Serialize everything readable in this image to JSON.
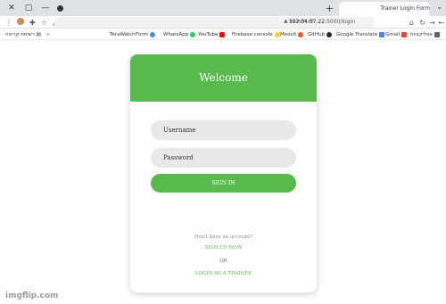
{
  "tab": {
    "title": "Trainer Login Form"
  },
  "toolbar": {
    "secure_label": "לא מאובטח",
    "url_host": "192.34.57.22",
    "url_path": ":5000/login"
  },
  "bookmarks": [
    {
      "label": "TeraWatch"
    },
    {
      "label": "Form"
    },
    {
      "label": "WhatsApp"
    },
    {
      "label": "YouTube"
    },
    {
      "label": "Firebase console"
    },
    {
      "label": "Moovit"
    },
    {
      "label": "GitHub"
    },
    {
      "label": "Google Translate"
    },
    {
      "label": "Gmail"
    },
    {
      "label": "אפליקציות"
    },
    {
      "label": "רשימת קריאה"
    }
  ],
  "card": {
    "title": "Welcome",
    "username_placeholder": "Username",
    "password_placeholder": "Password",
    "signin_label": "SIGN IN",
    "prompt": "Don't have an account?",
    "signup_label": "SIGN UP NOW",
    "or_label": "OR",
    "trainee_label": "LOGIN AS A TRAINEE"
  },
  "colors": {
    "accent": "#58b94d"
  },
  "watermark": "imgflip.com"
}
